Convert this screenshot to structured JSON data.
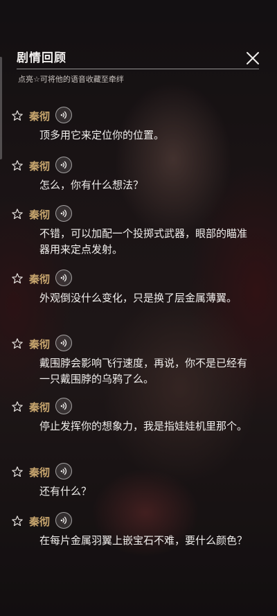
{
  "header": {
    "title": "剧情回顾",
    "subtitle": "点亮☆可将他的语音收藏至牵绊"
  },
  "colors": {
    "speaker": "#c9a76f",
    "text": "#f0eeec"
  },
  "entries": [
    {
      "speaker": "秦彻",
      "text": "顶多用它来定位你的位置。",
      "favorited": false
    },
    {
      "speaker": "秦彻",
      "text": "怎么，你有什么想法？",
      "favorited": false
    },
    {
      "speaker": "秦彻",
      "text": "不错，可以加配一个投掷式武器，眼部的瞄准器用来定点发射。",
      "favorited": false
    },
    {
      "speaker": "秦彻",
      "text": "外观倒没什么变化，只是换了层金属薄翼。",
      "favorited": false
    },
    {
      "speaker": "秦彻",
      "text": "戴围脖会影响飞行速度，再说，你不是已经有一只戴围脖的乌鸦了么。",
      "favorited": false
    },
    {
      "speaker": "秦彻",
      "text": "停止发挥你的想象力，我是指娃娃机里那个。",
      "favorited": false
    },
    {
      "speaker": "秦彻",
      "text": "还有什么？",
      "favorited": false
    },
    {
      "speaker": "秦彻",
      "text": "在每片金属羽翼上嵌宝石不难，要什么颜色？",
      "favorited": false
    }
  ],
  "icons": {
    "close": "close-icon",
    "star": "star-outline-icon",
    "voice": "voice-play-icon"
  }
}
